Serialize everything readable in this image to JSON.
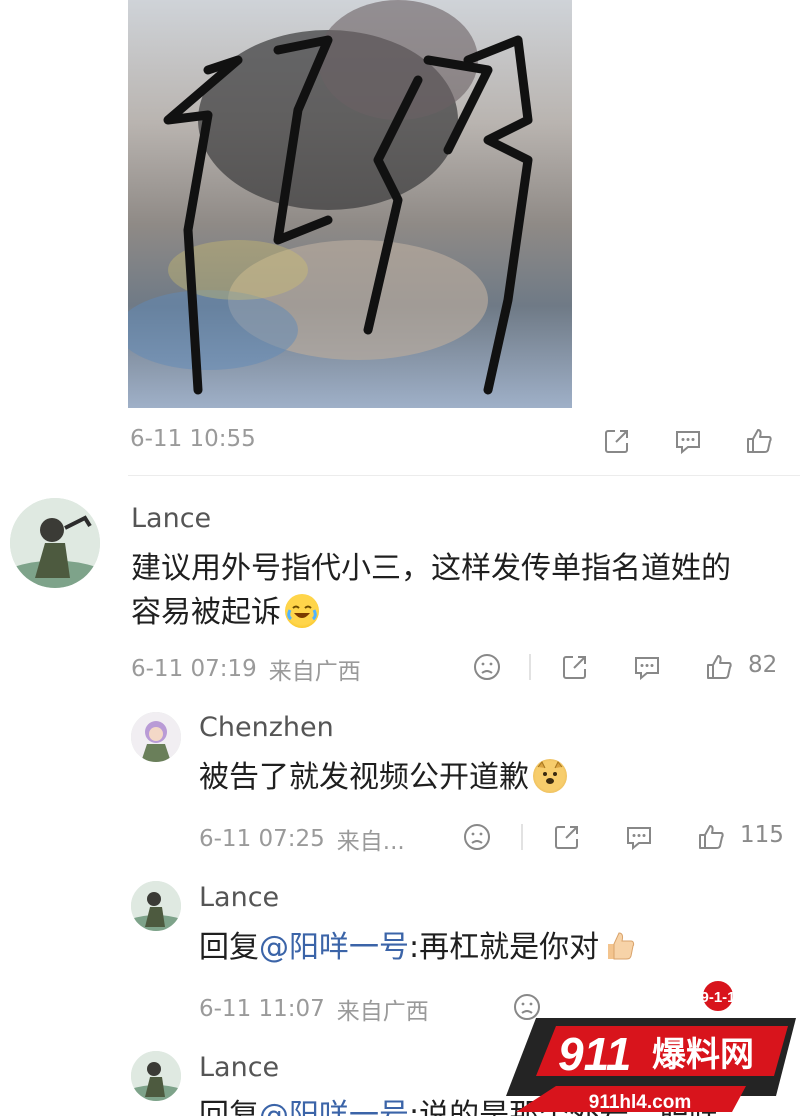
{
  "post": {
    "time": "6-11 10:55"
  },
  "comments": [
    {
      "name": "Lance",
      "text": "建议用外号指代小三，这样发传单指名道姓的",
      "text2": "容易被起诉",
      "time": "6-11 07:19",
      "location": "来自广西",
      "likes": "82"
    },
    {
      "name": "Chenzhen",
      "text": "被告了就发视频公开道歉",
      "time": "6-11 07:25",
      "location": "来自...",
      "likes": "115"
    },
    {
      "name": "Lance",
      "reply_prefix": "回复",
      "mention": "@阳咩一号",
      "text": ":再杠就是你对",
      "time": "6-11 11:07",
      "location": "来自广西"
    },
    {
      "name": "Lance",
      "reply_prefix": "回复",
      "mention": "@阳咩一号",
      "text": ":说的是那个外号，职咩"
    }
  ],
  "watermark": {
    "badge": "9-1-1",
    "brand_num": "911",
    "brand_text": "爆料网",
    "url": "911hl4.com"
  },
  "icons": [
    "share-icon",
    "comment-icon",
    "like-icon",
    "dislike-icon"
  ],
  "colors": {
    "mention": "#3b64a8",
    "meta": "#9a9a9a",
    "brand_red": "#d8141c"
  }
}
